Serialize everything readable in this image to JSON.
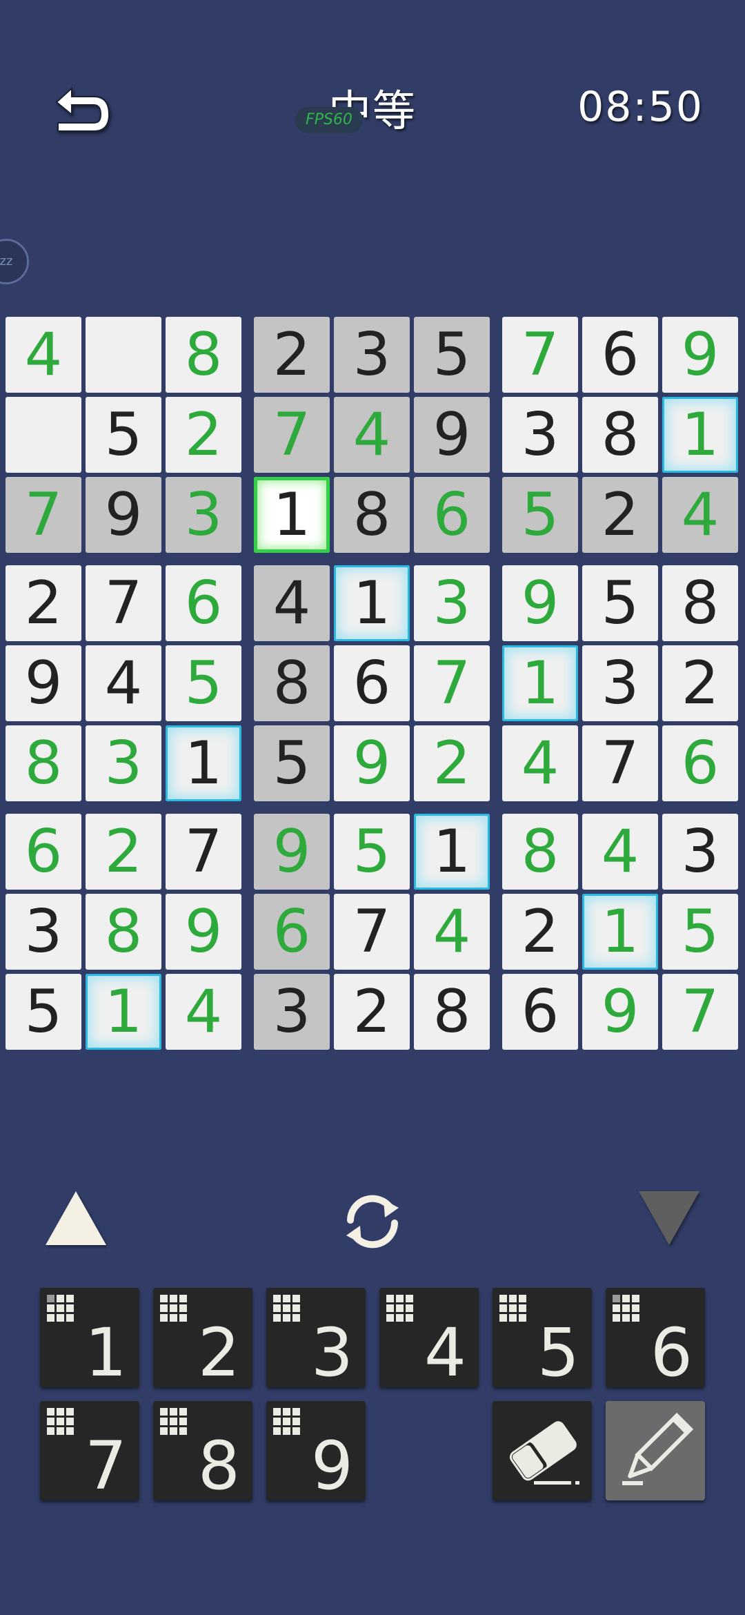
{
  "header": {
    "back_icon": "undo-arrow-icon",
    "title": "中等",
    "fps": "FPS60",
    "timer": "08:50",
    "pause_label": "zz"
  },
  "colors": {
    "background": "#313d66",
    "given_digit": "#222222",
    "entered_digit": "#2eaa3d",
    "selected_glow": "#35d04a",
    "highlight_glow": "#2bb8e0"
  },
  "board": {
    "selected": [
      2,
      3
    ],
    "rows": [
      [
        {
          "v": "4",
          "t": "e"
        },
        {
          "v": "",
          "t": ""
        },
        {
          "v": "8",
          "t": "e"
        },
        {
          "v": "2",
          "t": "g",
          "gray": true
        },
        {
          "v": "3",
          "t": "g",
          "gray": true
        },
        {
          "v": "5",
          "t": "g",
          "gray": true
        },
        {
          "v": "7",
          "t": "e"
        },
        {
          "v": "6",
          "t": "g"
        },
        {
          "v": "9",
          "t": "e"
        }
      ],
      [
        {
          "v": "",
          "t": ""
        },
        {
          "v": "5",
          "t": "g"
        },
        {
          "v": "2",
          "t": "e"
        },
        {
          "v": "7",
          "t": "e",
          "gray": true
        },
        {
          "v": "4",
          "t": "e",
          "gray": true
        },
        {
          "v": "9",
          "t": "g",
          "gray": true
        },
        {
          "v": "3",
          "t": "g"
        },
        {
          "v": "8",
          "t": "g"
        },
        {
          "v": "1",
          "t": "e",
          "hl": true
        }
      ],
      [
        {
          "v": "7",
          "t": "e",
          "gray": true
        },
        {
          "v": "9",
          "t": "g",
          "gray": true
        },
        {
          "v": "3",
          "t": "e",
          "gray": true
        },
        {
          "v": "1",
          "t": "g",
          "sel": true
        },
        {
          "v": "8",
          "t": "g",
          "gray": true
        },
        {
          "v": "6",
          "t": "e",
          "gray": true
        },
        {
          "v": "5",
          "t": "e",
          "gray": true
        },
        {
          "v": "2",
          "t": "g",
          "gray": true
        },
        {
          "v": "4",
          "t": "e",
          "gray": true
        }
      ],
      [
        {
          "v": "2",
          "t": "g"
        },
        {
          "v": "7",
          "t": "g"
        },
        {
          "v": "6",
          "t": "e"
        },
        {
          "v": "4",
          "t": "g",
          "gray": true
        },
        {
          "v": "1",
          "t": "g",
          "hl": true
        },
        {
          "v": "3",
          "t": "e"
        },
        {
          "v": "9",
          "t": "e"
        },
        {
          "v": "5",
          "t": "g"
        },
        {
          "v": "8",
          "t": "g"
        }
      ],
      [
        {
          "v": "9",
          "t": "g"
        },
        {
          "v": "4",
          "t": "g"
        },
        {
          "v": "5",
          "t": "e"
        },
        {
          "v": "8",
          "t": "g",
          "gray": true
        },
        {
          "v": "6",
          "t": "g"
        },
        {
          "v": "7",
          "t": "e"
        },
        {
          "v": "1",
          "t": "e",
          "hl": true
        },
        {
          "v": "3",
          "t": "g"
        },
        {
          "v": "2",
          "t": "g"
        }
      ],
      [
        {
          "v": "8",
          "t": "e"
        },
        {
          "v": "3",
          "t": "e"
        },
        {
          "v": "1",
          "t": "g",
          "hl": true
        },
        {
          "v": "5",
          "t": "g",
          "gray": true
        },
        {
          "v": "9",
          "t": "e"
        },
        {
          "v": "2",
          "t": "e"
        },
        {
          "v": "4",
          "t": "e"
        },
        {
          "v": "7",
          "t": "g"
        },
        {
          "v": "6",
          "t": "e"
        }
      ],
      [
        {
          "v": "6",
          "t": "e"
        },
        {
          "v": "2",
          "t": "e"
        },
        {
          "v": "7",
          "t": "g"
        },
        {
          "v": "9",
          "t": "e",
          "gray": true
        },
        {
          "v": "5",
          "t": "e"
        },
        {
          "v": "1",
          "t": "g",
          "hl": true
        },
        {
          "v": "8",
          "t": "e"
        },
        {
          "v": "4",
          "t": "e"
        },
        {
          "v": "3",
          "t": "g"
        }
      ],
      [
        {
          "v": "3",
          "t": "g"
        },
        {
          "v": "8",
          "t": "e"
        },
        {
          "v": "9",
          "t": "e"
        },
        {
          "v": "6",
          "t": "e",
          "gray": true
        },
        {
          "v": "7",
          "t": "g"
        },
        {
          "v": "4",
          "t": "e"
        },
        {
          "v": "2",
          "t": "g"
        },
        {
          "v": "1",
          "t": "e",
          "hl": true
        },
        {
          "v": "5",
          "t": "e"
        }
      ],
      [
        {
          "v": "5",
          "t": "g"
        },
        {
          "v": "1",
          "t": "e",
          "hl": true
        },
        {
          "v": "4",
          "t": "e"
        },
        {
          "v": "3",
          "t": "g",
          "gray": true
        },
        {
          "v": "2",
          "t": "g"
        },
        {
          "v": "8",
          "t": "g"
        },
        {
          "v": "6",
          "t": "g"
        },
        {
          "v": "9",
          "t": "e"
        },
        {
          "v": "7",
          "t": "e"
        }
      ]
    ]
  },
  "controls": {
    "up_icon": "triangle-up-icon",
    "refresh_icon": "refresh-icon",
    "down_icon": "triangle-down-icon"
  },
  "keypad": {
    "keys": [
      {
        "label": "1",
        "pips": 1
      },
      {
        "label": "2",
        "pips": 0
      },
      {
        "label": "3",
        "pips": 0
      },
      {
        "label": "4",
        "pips": 0
      },
      {
        "label": "5",
        "pips": 0
      },
      {
        "label": "6",
        "pips": 1
      },
      {
        "label": "7",
        "pips": 0
      },
      {
        "label": "8",
        "pips": 0
      },
      {
        "label": "9",
        "pips": 0
      }
    ],
    "eraser_icon": "eraser-icon",
    "pencil_icon": "pencil-icon"
  }
}
